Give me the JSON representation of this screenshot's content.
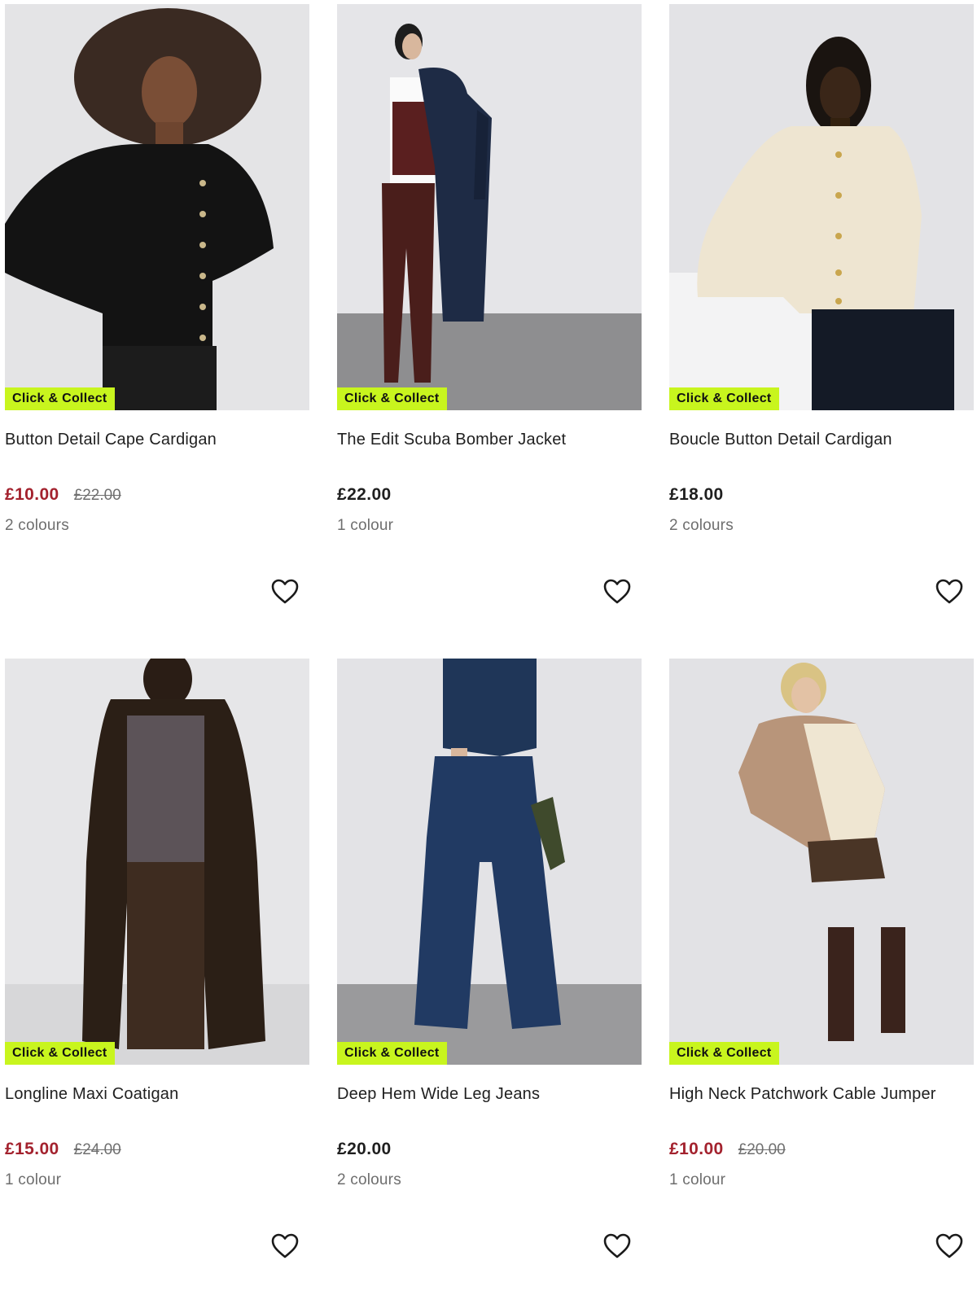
{
  "badge_label": "Click & Collect",
  "colors": {
    "sale_price": "#a3222e",
    "badge_bg": "#c8f51e",
    "text": "#1f1f1f",
    "muted": "#6e6e6e"
  },
  "products": [
    {
      "title": "Button Detail Cape Cardigan",
      "price": "£10.00",
      "was_price": "£22.00",
      "colours": "2 colours",
      "on_sale": true,
      "image_icon": "model-black-cape-cardigan"
    },
    {
      "title": "The Edit Scuba Bomber Jacket",
      "price": "£22.00",
      "was_price": "",
      "colours": "1 colour",
      "on_sale": false,
      "image_icon": "model-burgundy-bomber-jacket"
    },
    {
      "title": "Boucle Button Detail Cardigan",
      "price": "£18.00",
      "was_price": "",
      "colours": "2 colours",
      "on_sale": false,
      "image_icon": "model-cream-boucle-cardigan"
    },
    {
      "title": "Longline Maxi Coatigan",
      "price": "£15.00",
      "was_price": "£24.00",
      "colours": "1 colour",
      "on_sale": true,
      "image_icon": "model-brown-maxi-coatigan"
    },
    {
      "title": "Deep Hem Wide Leg Jeans",
      "price": "£20.00",
      "was_price": "",
      "colours": "2 colours",
      "on_sale": false,
      "image_icon": "model-wide-leg-jeans"
    },
    {
      "title": "High Neck Patchwork Cable Jumper",
      "price": "£10.00",
      "was_price": "£20.00",
      "colours": "1 colour",
      "on_sale": true,
      "image_icon": "model-patchwork-cable-jumper"
    }
  ]
}
